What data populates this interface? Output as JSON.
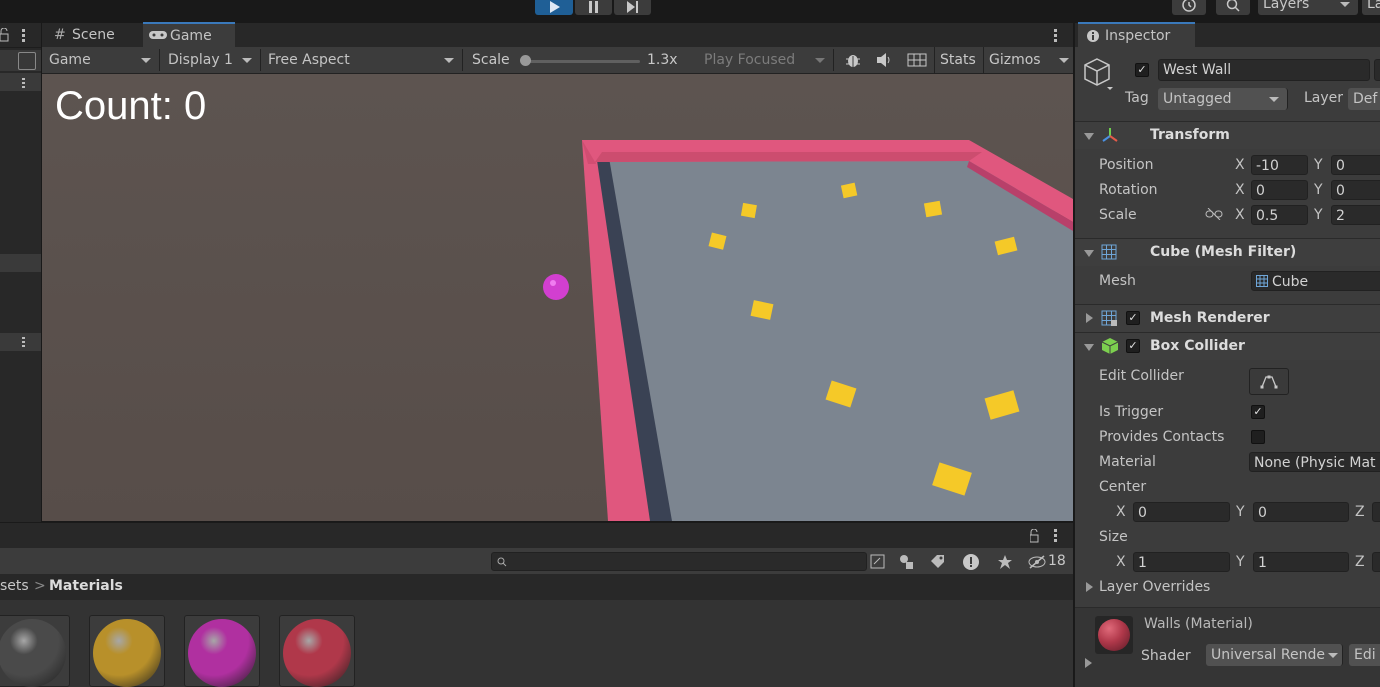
{
  "toolbar": {
    "layers_label": "Layers",
    "layout_label": "La"
  },
  "game_view": {
    "tabs": [
      {
        "label": "Scene",
        "icon": "hash-icon"
      },
      {
        "label": "Game",
        "icon": "gamepad-icon"
      }
    ],
    "game_dropdown": "Game",
    "display_dropdown": "Display 1",
    "aspect_dropdown": "Free Aspect",
    "scale_label": "Scale",
    "scale_value": "1.3x",
    "play_focused": "Play Focused",
    "stats_label": "Stats",
    "gizmos_label": "Gizmos",
    "hud_count": "Count: 0"
  },
  "project": {
    "breadcrumb_parent": "sets",
    "breadcrumb_current": "Materials",
    "hidden_count": "18",
    "materials": [
      {
        "name": "gray",
        "color": "#4a4a4a"
      },
      {
        "name": "yellow",
        "color": "#b8902a"
      },
      {
        "name": "pink",
        "color": "#b030a0"
      },
      {
        "name": "red",
        "color": "#b0384a"
      }
    ]
  },
  "inspector": {
    "tab_label": "Inspector",
    "object_name": "West Wall",
    "tag_label": "Tag",
    "tag_value": "Untagged",
    "layer_label": "Layer",
    "layer_value": "Def",
    "transform": {
      "title": "Transform",
      "position_label": "Position",
      "rotation_label": "Rotation",
      "scale_label": "Scale",
      "position": {
        "x": "-10",
        "y": "0"
      },
      "rotation": {
        "x": "0",
        "y": "0"
      },
      "scale": {
        "x": "0.5",
        "y": "2"
      }
    },
    "mesh_filter": {
      "title": "Cube (Mesh Filter)",
      "mesh_label": "Mesh",
      "mesh_value": "Cube"
    },
    "mesh_renderer": {
      "title": "Mesh Renderer"
    },
    "box_collider": {
      "title": "Box Collider",
      "edit_collider_label": "Edit Collider",
      "is_trigger_label": "Is Trigger",
      "provides_contacts_label": "Provides Contacts",
      "material_label": "Material",
      "material_value": "None (Physic Mat",
      "center_label": "Center",
      "center": {
        "x": "0",
        "y": "0",
        "z_label": "Z"
      },
      "size_label": "Size",
      "size": {
        "x": "1",
        "y": "1",
        "z_label": "Z"
      },
      "layer_overrides_label": "Layer Overrides"
    },
    "material_footer": {
      "name": "Walls (Material)",
      "shader_label": "Shader",
      "shader_value": "Universal Rende",
      "edit_label": "Edi"
    },
    "axis_x": "X",
    "axis_y": "Y"
  },
  "colors": {
    "wall": "#e0577e",
    "floor": "#7c8590",
    "sky": "#5a504c",
    "player": "#d23fd0",
    "pickup": "#f5c928",
    "accent": "#3a79bb"
  }
}
